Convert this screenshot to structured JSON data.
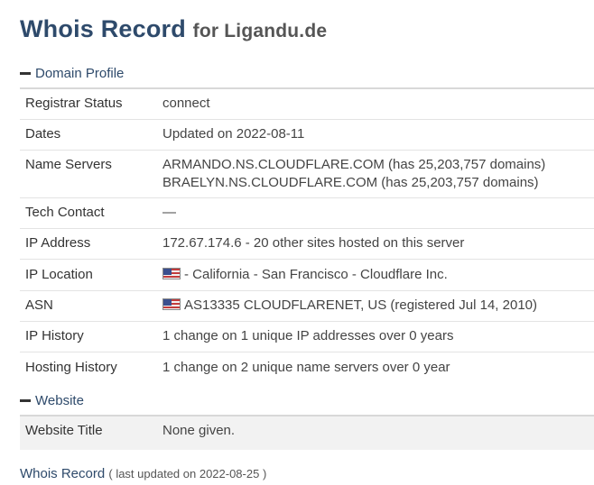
{
  "header": {
    "title": "Whois Record",
    "subtitle": "for Ligandu.de"
  },
  "domain_profile": {
    "heading": "Domain Profile",
    "rows": {
      "registrar_status": {
        "label": "Registrar Status",
        "value": "connect"
      },
      "dates": {
        "label": "Dates",
        "value": "Updated on 2022-08-11"
      },
      "name_servers": {
        "label": "Name Servers",
        "values": [
          "ARMANDO.NS.CLOUDFLARE.COM (has 25,203,757 domains)",
          "BRAELYN.NS.CLOUDFLARE.COM (has 25,203,757 domains)"
        ]
      },
      "tech_contact": {
        "label": "Tech Contact",
        "value": "—"
      },
      "ip_address": {
        "label": "IP Address",
        "value": "172.67.174.6 - 20 other sites hosted on this server"
      },
      "ip_location": {
        "label": "IP Location",
        "value": "- California - San Francisco - Cloudflare Inc.",
        "flag_icon": "us-flag-icon"
      },
      "asn": {
        "label": "ASN",
        "value": "AS13335 CLOUDFLARENET, US (registered Jul 14, 2010)",
        "flag_icon": "us-flag-icon"
      },
      "ip_history": {
        "label": "IP History",
        "value": "1 change on 1 unique IP addresses over 0 years"
      },
      "hosting_history": {
        "label": "Hosting History",
        "value": "1 change on 2 unique name servers over 0 year"
      }
    }
  },
  "website": {
    "heading": "Website",
    "rows": {
      "website_title": {
        "label": "Website Title",
        "value": "None given."
      }
    }
  },
  "footer": {
    "link": "Whois Record",
    "note": "( last updated on 2022-08-25 )"
  },
  "colors": {
    "heading": "#2e4a6b",
    "row_border": "#e3e3e3",
    "website_row_bg": "#f2f2f2"
  }
}
